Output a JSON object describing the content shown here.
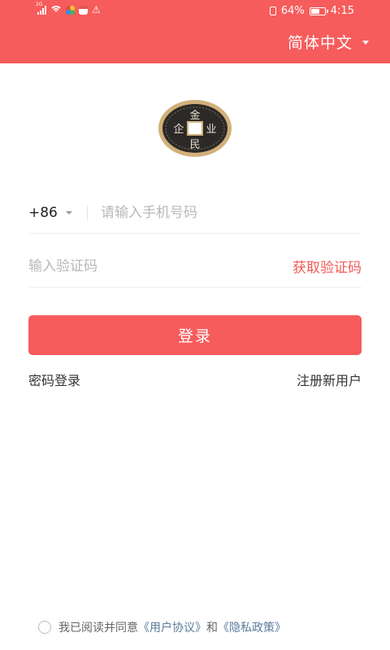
{
  "status_bar": {
    "network": "2G",
    "battery": "64%",
    "battery_level": 0.64,
    "time": "4:15"
  },
  "header": {
    "language": "简体中文",
    "bg_color": "#f65c5c"
  },
  "form": {
    "country_code": "+86",
    "phone_placeholder": "请输入手机号码",
    "code_placeholder": "输入验证码",
    "get_code_label": "获取验证码",
    "login_label": "登录",
    "password_login_label": "密码登录",
    "register_label": "注册新用户"
  },
  "agreement": {
    "prefix": "我已阅读并同意",
    "user_agreement": "《用户协议》",
    "conjunction": "和",
    "privacy_policy": "《隐私政策》",
    "checked": false
  },
  "logo": {
    "chars": [
      "金",
      "业",
      "民",
      "企"
    ]
  },
  "colors": {
    "accent": "#f65c5c",
    "link": "#5b7a9b",
    "get_code": "#f35a57"
  }
}
